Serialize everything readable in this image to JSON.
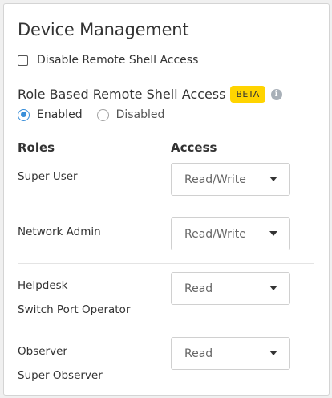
{
  "section": {
    "title": "Device Management"
  },
  "disable_shell": {
    "label": "Disable Remote Shell Access",
    "checked": false
  },
  "rbac": {
    "label": "Role Based Remote Shell Access",
    "badge": "BETA",
    "info_icon": "info-icon",
    "options": [
      {
        "label": "Enabled",
        "selected": true
      },
      {
        "label": "Disabled",
        "selected": false
      }
    ]
  },
  "table": {
    "headers": {
      "roles": "Roles",
      "access": "Access"
    },
    "rows": [
      {
        "roles": [
          "Super User"
        ],
        "access": "Read/Write"
      },
      {
        "roles": [
          "Network Admin"
        ],
        "access": "Read/Write"
      },
      {
        "roles": [
          "Helpdesk",
          "Switch Port Operator"
        ],
        "access": "Read"
      },
      {
        "roles": [
          "Observer",
          "Super Observer"
        ],
        "access": "Read"
      }
    ]
  },
  "colors": {
    "badge_bg": "#ffd400",
    "radio_selected": "#3a8fd9"
  }
}
